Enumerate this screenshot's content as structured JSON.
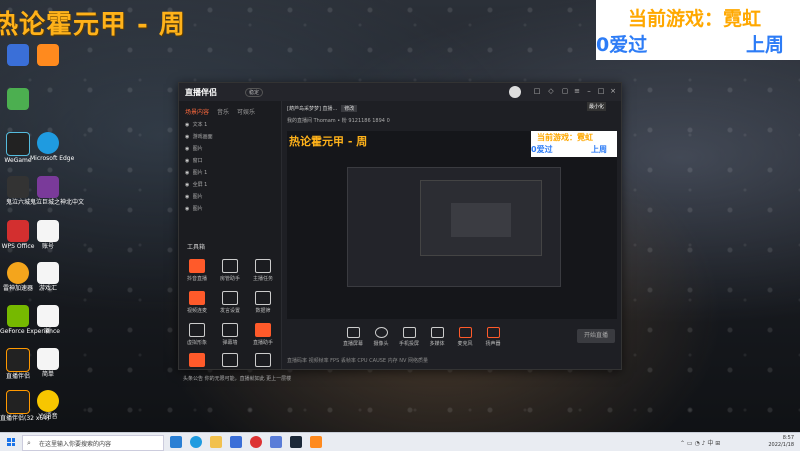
{
  "overlay": {
    "title": "热论霍元甲 - 周",
    "current_game_label": "当前游戏：",
    "current_game_value": "霓虹",
    "line2_left": "0爱过",
    "line2_right": "上周"
  },
  "desktop_icons": [
    {
      "label": ""
    },
    {
      "label": ""
    },
    {
      "label": ""
    },
    {
      "label": "WeGame"
    },
    {
      "label": "Microsoft Edge"
    },
    {
      "label": "鬼泣六城"
    },
    {
      "label": "鬼泣巨城之神北中文"
    },
    {
      "label": "WPS Office"
    },
    {
      "label": "账号"
    },
    {
      "label": "雷神加速器"
    },
    {
      "label": "游戏汇"
    },
    {
      "label": "GeForce Experience"
    },
    {
      "label": "新"
    },
    {
      "label": "直播伴侣"
    },
    {
      "label": "简单"
    },
    {
      "label": "直播伴侣(32 x64)"
    },
    {
      "label": "YY语音"
    }
  ],
  "app": {
    "name": "直播伴侣",
    "version": "稳定",
    "tooltip": "最小化",
    "left_tabs": [
      "场景内容",
      "音乐",
      "可娱乐"
    ],
    "layers": [
      {
        "name": "文本 1"
      },
      {
        "name": "游戏画面"
      },
      {
        "name": "图片"
      },
      {
        "name": "窗口"
      },
      {
        "name": "图片 1"
      },
      {
        "name": "全屏 1"
      },
      {
        "name": "图片"
      },
      {
        "name": "图片"
      }
    ],
    "tools_label": "工具箱",
    "tools": [
      {
        "label": "抖音直播"
      },
      {
        "label": "房管助手"
      },
      {
        "label": "主播任务"
      },
      {
        "label": "视频连麦"
      },
      {
        "label": "发言设置"
      },
      {
        "label": "数据筛"
      },
      {
        "label": "虚拟形象"
      },
      {
        "label": "弹幕墙"
      },
      {
        "label": "直播助手"
      },
      {
        "label": ""
      },
      {
        "label": ""
      },
      {
        "label": ""
      }
    ],
    "status_left": "头条公告  你的无限可能，直播就如此  更上一层楼",
    "room_info": "[葫芦岛采梦梦] 直播...",
    "room_badge": "修改",
    "room_info2": "我的直播间  Thomam • 粉  9121186  1894  0",
    "preview": {
      "title": "热论霍元甲 - 周",
      "l1": "当前游戏：霓虹",
      "l2_left": "0爱过",
      "l2_right": "上周"
    },
    "bottom_tools": [
      {
        "label": "直播屏幕"
      },
      {
        "label": "摄像头"
      },
      {
        "label": "手机投屏"
      },
      {
        "label": "多媒体"
      },
      {
        "label": "麦克风"
      },
      {
        "label": "扬声器"
      }
    ],
    "start_button": "开始直播",
    "status_right": "直播码率  视频帧率  FPS  丢帧率  CPU  CAUSE  内存  NV  网络质量"
  },
  "taskbar": {
    "search_placeholder": "在这里输入你要搜索的内容",
    "time": "8:57",
    "date": "2022/1/18"
  },
  "colors": {
    "overlay_orange": "#ffb21a",
    "overlay_blue": "#2d7cf6",
    "accent": "#ff5a2a",
    "window_bg": "#1e1f24"
  }
}
